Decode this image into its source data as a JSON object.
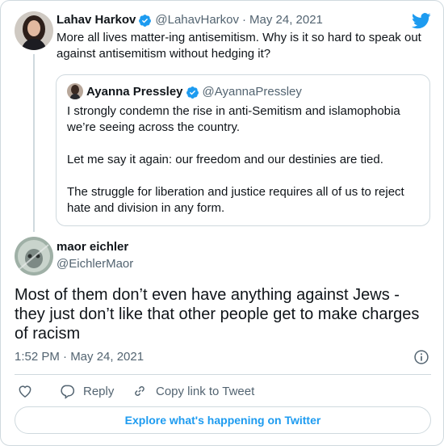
{
  "parent_tweet": {
    "author_name": "Lahav Harkov",
    "author_handle": "@LahavHarkov",
    "separator": "·",
    "date": "May 24, 2021",
    "text": "More all lives matter-ing antisemitism. Why is it so hard to speak out against antisemitism without hedging it?"
  },
  "quoted_tweet": {
    "author_name": "Ayanna Pressley",
    "author_handle": "@AyannaPressley",
    "paragraphs": [
      "I strongly condemn the rise in anti-Semitism and islamophobia we’re seeing across the country.",
      "Let me say it again: our freedom and our destinies are tied.",
      "The struggle for liberation and justice requires all of us to reject hate and division in any form."
    ]
  },
  "reply_tweet": {
    "author_name": "maor eichler",
    "author_handle": "@EichlerMaor",
    "text": "Most of them don’t even have anything against Jews - they just don’t like that other people get to make charges of racism",
    "timestamp": "1:52 PM · May 24, 2021"
  },
  "actions": {
    "reply_label": "Reply",
    "copy_label": "Copy link to Tweet"
  },
  "footer": {
    "explore_label": "Explore what's happening on Twitter"
  },
  "colors": {
    "accent": "#1d9bf0",
    "text": "#0f1419",
    "secondary": "#536471",
    "border": "#cfd9de"
  },
  "icons": [
    "twitter-bird-icon",
    "verified-badge-icon",
    "info-icon",
    "heart-icon",
    "reply-icon",
    "link-icon"
  ]
}
